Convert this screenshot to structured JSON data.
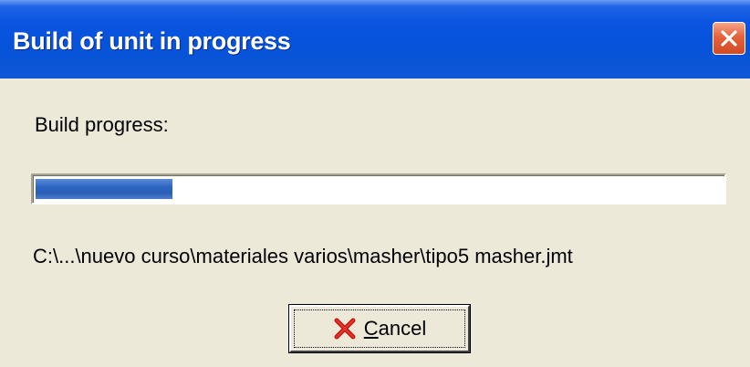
{
  "window": {
    "title": "Build of unit in progress",
    "close_icon": "close-icon",
    "accent_color": "#0a54e0",
    "close_color": "#e4623c"
  },
  "content": {
    "progress_label": "Build progress:",
    "progress_fraction": 0.2,
    "progress_color": "#2d66c2",
    "current_file": "C:\\...\\nuevo curso\\materiales varios\\masher\\tipo5  masher.jmt"
  },
  "buttons": {
    "cancel": {
      "label_mnemonic": "C",
      "label_rest": "ancel",
      "icon": "red-x-icon",
      "icon_color": "#c81414"
    }
  }
}
